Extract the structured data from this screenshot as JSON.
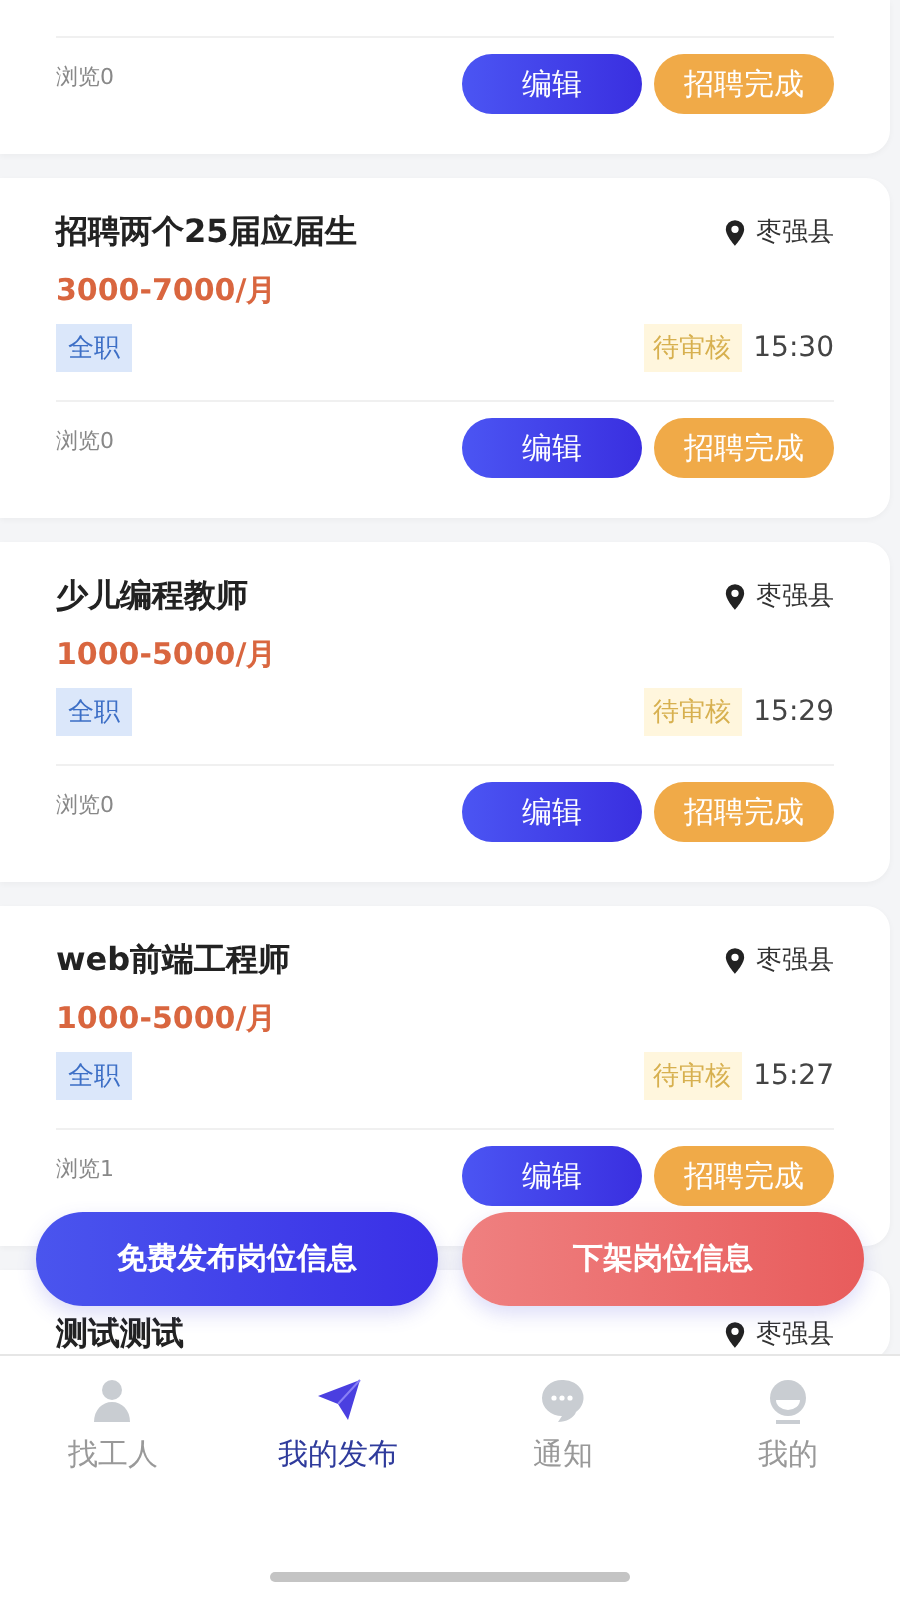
{
  "jobs": [
    {
      "kind": "partial",
      "views": "浏览0",
      "actions": [
        "编辑",
        "招聘完成"
      ]
    },
    {
      "kind": "full",
      "title": "招聘两个25届应届生",
      "location": "枣强县",
      "salary": "3000-7000/月",
      "tag": "全职",
      "status": "待审核",
      "time": "15:30",
      "views": "浏览0",
      "actions": [
        "编辑",
        "招聘完成"
      ]
    },
    {
      "kind": "full",
      "title": "少儿编程教师",
      "location": "枣强县",
      "salary": "1000-5000/月",
      "tag": "全职",
      "status": "待审核",
      "time": "15:29",
      "views": "浏览0",
      "actions": [
        "编辑",
        "招聘完成"
      ]
    },
    {
      "kind": "full",
      "title": "web前端工程师",
      "location": "枣强县",
      "salary": "1000-5000/月",
      "tag": "全职",
      "status": "待审核",
      "time": "15:27",
      "views": "浏览1",
      "actions": [
        "编辑",
        "招聘完成"
      ]
    },
    {
      "kind": "head",
      "title": "测试测试",
      "location": "枣强县"
    }
  ],
  "floating_actions": [
    "免费发布岗位信息",
    "下架岗位信息"
  ],
  "tabs": [
    {
      "kind": "worker",
      "label": "找工人",
      "selected": false
    },
    {
      "kind": "plane",
      "label": "我的发布",
      "selected": true
    },
    {
      "kind": "chat",
      "label": "通知",
      "selected": false
    },
    {
      "kind": "face",
      "label": "我的",
      "selected": false
    }
  ]
}
